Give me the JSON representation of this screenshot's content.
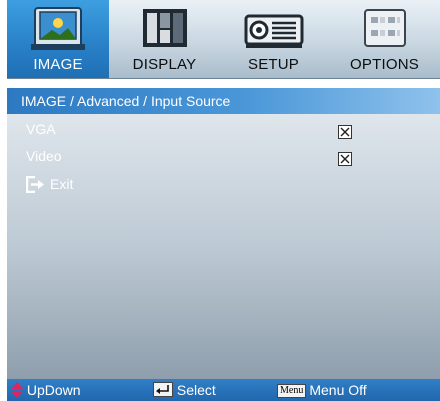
{
  "tabs": [
    {
      "label": "IMAGE",
      "active": true,
      "icon": "image-icon"
    },
    {
      "label": "DISPLAY",
      "active": false,
      "icon": "display-icon"
    },
    {
      "label": "SETUP",
      "active": false,
      "icon": "projector-icon"
    },
    {
      "label": "OPTIONS",
      "active": false,
      "icon": "options-icon"
    }
  ],
  "breadcrumb": "IMAGE / Advanced / Input Source",
  "items": [
    {
      "label": "VGA",
      "checked": true
    },
    {
      "label": "Video",
      "checked": true
    }
  ],
  "exit_label": "Exit",
  "footer": {
    "updown_label": "UpDown",
    "select_label": "Select",
    "menu_key_label": "Menu",
    "menu_off_label": "Menu Off"
  },
  "colors": {
    "active_tab": "#2a82c9",
    "breadcrumb": "#3d8bd0",
    "footer": "#2470b8",
    "footer_arrow": "#e0245e"
  }
}
